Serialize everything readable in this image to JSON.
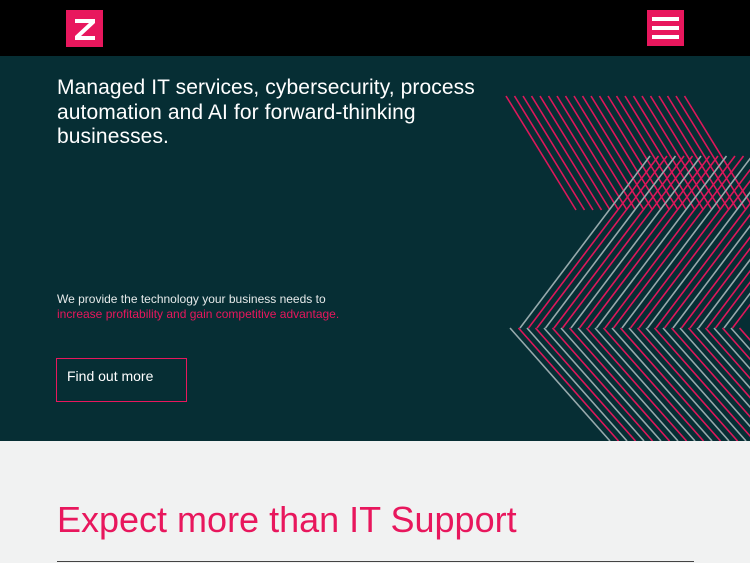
{
  "header": {
    "logo_letter": "Z",
    "logo_icon": "brand-z-logo",
    "menu_icon": "hamburger-menu-icon"
  },
  "hero": {
    "headline": "Managed IT services, cybersecurity, process automation and AI for forward-thinking businesses.",
    "intro_line1": "We provide the technology your business needs to",
    "intro_line2": "increase profitability and gain competitive advantage.",
    "cta_label": "Find out more"
  },
  "section": {
    "title": "Expect more than IT Support"
  },
  "colors": {
    "accent": "#e8175d",
    "hero_bg": "#062e34",
    "header_bg": "#000000",
    "page_bg": "#f1f2f2",
    "stripe_light": "#9fb0b3"
  }
}
